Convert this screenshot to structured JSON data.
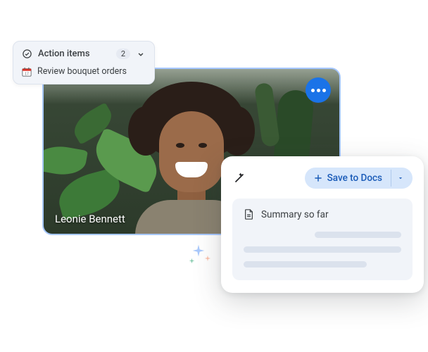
{
  "video": {
    "participant_name": "Leonie Bennett"
  },
  "action_items": {
    "header_label": "Action items",
    "count": "2",
    "items": [
      {
        "label": "Review bouquet orders"
      }
    ]
  },
  "summary": {
    "save_button_label": "Save to Docs",
    "title": "Summary so far"
  },
  "colors": {
    "accent_blue": "#1a73e8",
    "pill_blue": "#d6e6fb",
    "panel_bg": "#f1f4f9"
  }
}
